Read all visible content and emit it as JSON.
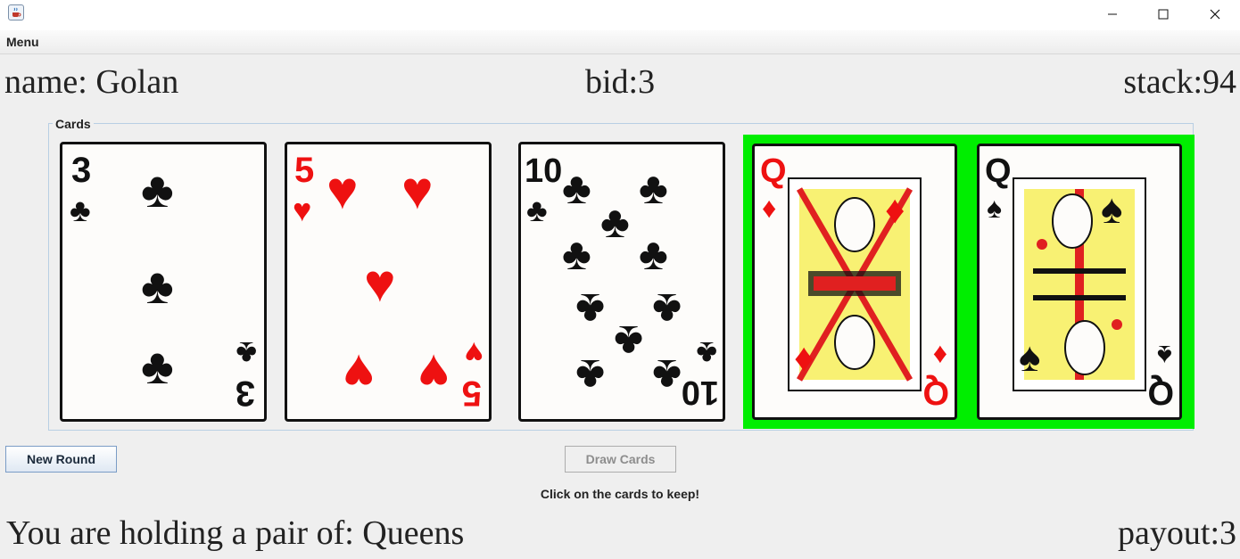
{
  "window": {
    "app_icon": "java-cup-icon",
    "controls": [
      "minimize-icon",
      "maximize-icon",
      "close-icon"
    ]
  },
  "menubar": {
    "menu_label": "Menu"
  },
  "header": {
    "name": "name: Golan",
    "bid": "bid:3",
    "stack": "stack:94"
  },
  "cards_group": {
    "label": "Cards",
    "cards": [
      {
        "rank": "3",
        "suit": "clubs",
        "held": false
      },
      {
        "rank": "5",
        "suit": "hearts",
        "held": false
      },
      {
        "rank": "10",
        "suit": "clubs",
        "held": false
      },
      {
        "rank": "Q",
        "suit": "diamonds",
        "held": true
      },
      {
        "rank": "Q",
        "suit": "spades",
        "held": true
      }
    ],
    "held_color": "#00ee00"
  },
  "controls": {
    "new_round_label": "New Round",
    "draw_cards_label": "Draw Cards",
    "hint": "Click on the cards to keep!"
  },
  "status": {
    "holding": "You are holding a pair of: Queens",
    "payout": "payout:3"
  }
}
